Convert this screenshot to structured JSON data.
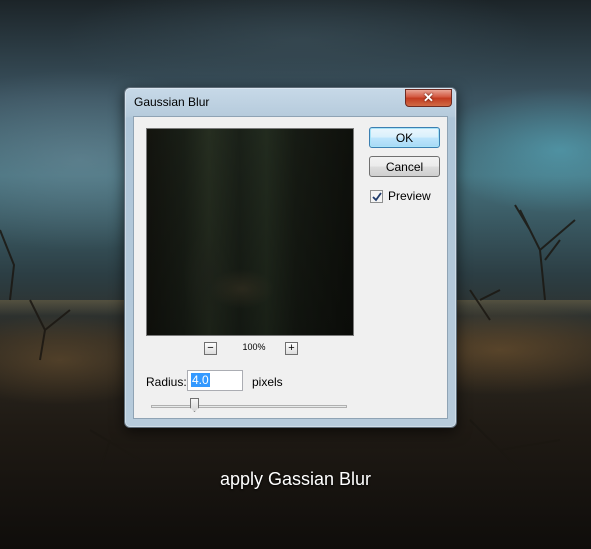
{
  "dialog": {
    "title": "Gaussian Blur",
    "close_glyph": "✕",
    "ok_label": "OK",
    "cancel_label": "Cancel",
    "preview_checkbox": {
      "label": "Preview",
      "checked": true
    },
    "zoom": {
      "minus": "−",
      "level": "100%",
      "plus": "+"
    },
    "radius": {
      "label": "Radius:",
      "value": "4.0",
      "unit": "pixels"
    },
    "slider": {
      "value": 4.0,
      "range": [
        0.1,
        1000
      ]
    }
  },
  "caption": "apply Gassian Blur",
  "colors": {
    "close_button": "#c23a20",
    "ok_button_border": "#3c7fb1",
    "selection": "#3399ff"
  },
  "icons": [
    "close-icon",
    "checkmark-icon",
    "zoom-out-icon",
    "zoom-in-icon"
  ]
}
